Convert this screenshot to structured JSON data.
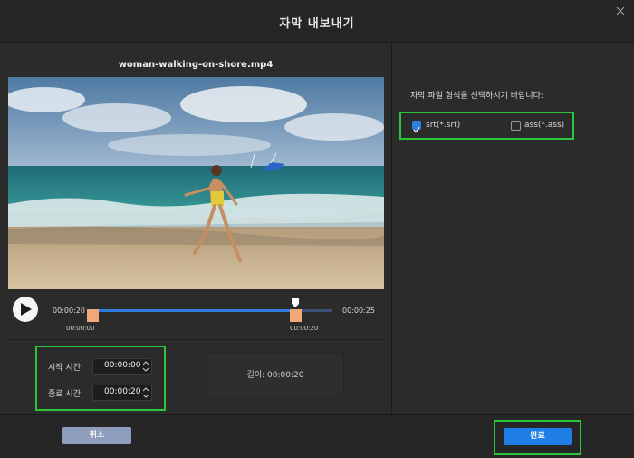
{
  "window": {
    "title": "자막 내보내기",
    "close_icon": "close-icon"
  },
  "preview": {
    "filename": "woman-walking-on-shore.mp4",
    "play_icon": "play-icon",
    "current_time": "00:00:20",
    "duration": "00:00:25",
    "range_start_label": "00:00:00",
    "range_end_label": "00:00:20"
  },
  "range": {
    "start_label": "시작 시간:",
    "start_value": "00:00:00",
    "end_label": "종료 시간:",
    "end_value": "00:00:20",
    "length_label": "길이:",
    "length_value": "00:00:20"
  },
  "format": {
    "prompt": "자막 파일 형식을 선택하시기 바랍니다:",
    "options": [
      {
        "label": "srt(*.srt)",
        "checked": true
      },
      {
        "label": "ass(*.ass)",
        "checked": false
      }
    ]
  },
  "footer": {
    "cancel_label": "취소",
    "done_label": "완료"
  },
  "colors": {
    "accent": "#1f7ee6",
    "highlight_box": "#2cc43a",
    "marker": "#f0a878"
  }
}
